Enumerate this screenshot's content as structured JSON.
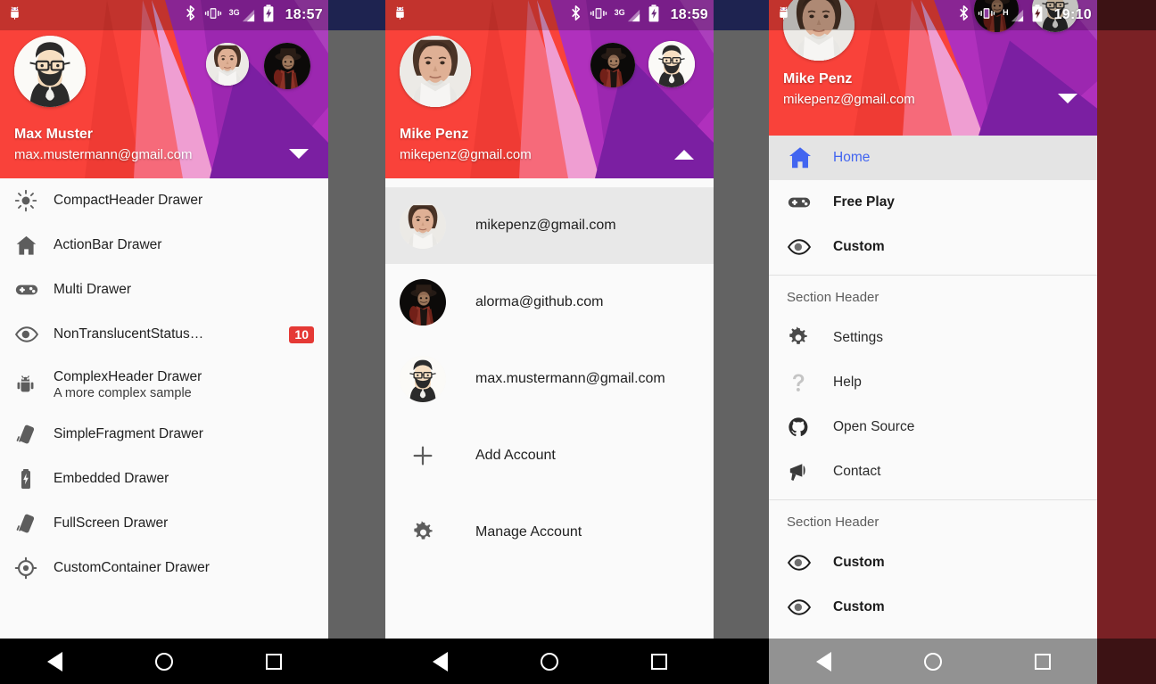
{
  "background": {
    "page_bg": "#7a2125",
    "scrim": "#636363",
    "gutter_top": "#1e2350"
  },
  "panels": [
    {
      "id": "panel1",
      "status_bar": {
        "time": "18:57",
        "network": "3G",
        "icons": [
          "android-notification-icon",
          "bluetooth-icon",
          "vibrate-icon",
          "signal-icon",
          "battery-charging-icon"
        ]
      },
      "header": {
        "name": "Max Muster",
        "email": "max.mustermann@gmail.com",
        "arrow": "chevron-down-icon",
        "avatar": "max-avatar",
        "mini_avatars": [
          "mike-avatar",
          "alorma-avatar"
        ]
      },
      "items": [
        {
          "icon": "brightness-icon",
          "label": "CompactHeader Drawer"
        },
        {
          "icon": "home-icon",
          "label": "ActionBar Drawer"
        },
        {
          "icon": "gamepad-icon",
          "label": "Multi Drawer"
        },
        {
          "icon": "eye-icon",
          "label": "NonTranslucentStatus…",
          "badge": "10"
        },
        {
          "icon": "android-icon",
          "label": "ComplexHeader Drawer",
          "description": "A more complex sample"
        },
        {
          "icon": "phone-icon",
          "label": "SimpleFragment Drawer"
        },
        {
          "icon": "battery-icon",
          "label": "Embedded Drawer"
        },
        {
          "icon": "phone-icon",
          "label": "FullScreen Drawer"
        },
        {
          "icon": "target-icon",
          "label": "CustomContainer Drawer"
        }
      ],
      "navbar": {
        "style": "opaque",
        "buttons": [
          "back-icon",
          "home-circle-icon",
          "recents-icon"
        ]
      }
    },
    {
      "id": "panel2",
      "status_bar": {
        "time": "18:59",
        "network": "3G",
        "icons": [
          "android-notification-icon",
          "bluetooth-icon",
          "vibrate-icon",
          "signal-icon",
          "battery-charging-icon"
        ]
      },
      "header": {
        "name": "Mike Penz",
        "email": "mikepenz@gmail.com",
        "arrow": "chevron-up-icon",
        "avatar": "mike-avatar",
        "mini_avatars": [
          "alorma-avatar",
          "max-avatar"
        ]
      },
      "accounts": [
        {
          "avatar": "mike-avatar",
          "email": "mikepenz@gmail.com",
          "active": true
        },
        {
          "avatar": "alorma-avatar",
          "email": "alorma@github.com",
          "active": false
        },
        {
          "avatar": "max-avatar",
          "email": "max.mustermann@gmail.com",
          "active": false
        }
      ],
      "account_actions": [
        {
          "icon": "plus-icon",
          "label": "Add Account"
        },
        {
          "icon": "gear-icon",
          "label": "Manage Account"
        }
      ],
      "navbar": {
        "style": "opaque",
        "buttons": [
          "back-icon",
          "home-circle-icon",
          "recents-icon"
        ]
      }
    },
    {
      "id": "panel3",
      "status_bar": {
        "time": "19:10",
        "network": "H",
        "icons": [
          "android-notification-icon",
          "bluetooth-icon",
          "vibrate-icon",
          "signal-icon",
          "battery-charging-icon"
        ]
      },
      "header": {
        "name": "Mike Penz",
        "email": "mikepenz@gmail.com",
        "arrow": "chevron-down-icon",
        "avatar": "mike-avatar",
        "mini_avatars": [
          "alorma-avatar",
          "max-avatar"
        ]
      },
      "items": [
        {
          "icon": "home-icon",
          "label": "Home",
          "selected": true
        },
        {
          "icon": "gamepad-icon",
          "label": "Free Play"
        },
        {
          "icon": "eye-icon",
          "label": "Custom"
        },
        {
          "type": "divider"
        },
        {
          "type": "section",
          "label": "Section Header"
        },
        {
          "icon": "gear-icon",
          "label": "Settings",
          "plain": true
        },
        {
          "icon": "question-icon",
          "label": "Help",
          "plain": true,
          "disabled": true
        },
        {
          "icon": "github-icon",
          "label": "Open Source",
          "plain": true
        },
        {
          "icon": "megaphone-icon",
          "label": "Contact",
          "plain": true
        },
        {
          "type": "divider"
        },
        {
          "type": "section",
          "label": "Section Header"
        },
        {
          "icon": "eye-icon",
          "label": "Custom"
        },
        {
          "icon": "eye-icon",
          "label": "Custom"
        }
      ],
      "navbar": {
        "style": "translucent",
        "buttons": [
          "back-icon",
          "home-circle-icon",
          "recents-icon"
        ]
      }
    }
  ],
  "colors": {
    "accent_blue": "#4265f0",
    "badge_red": "#e53935",
    "header_red": "#f9423a",
    "header_purple": "#9c27b0",
    "list_bg": "#fafafa",
    "selected_bg": "#e4e4e4"
  }
}
